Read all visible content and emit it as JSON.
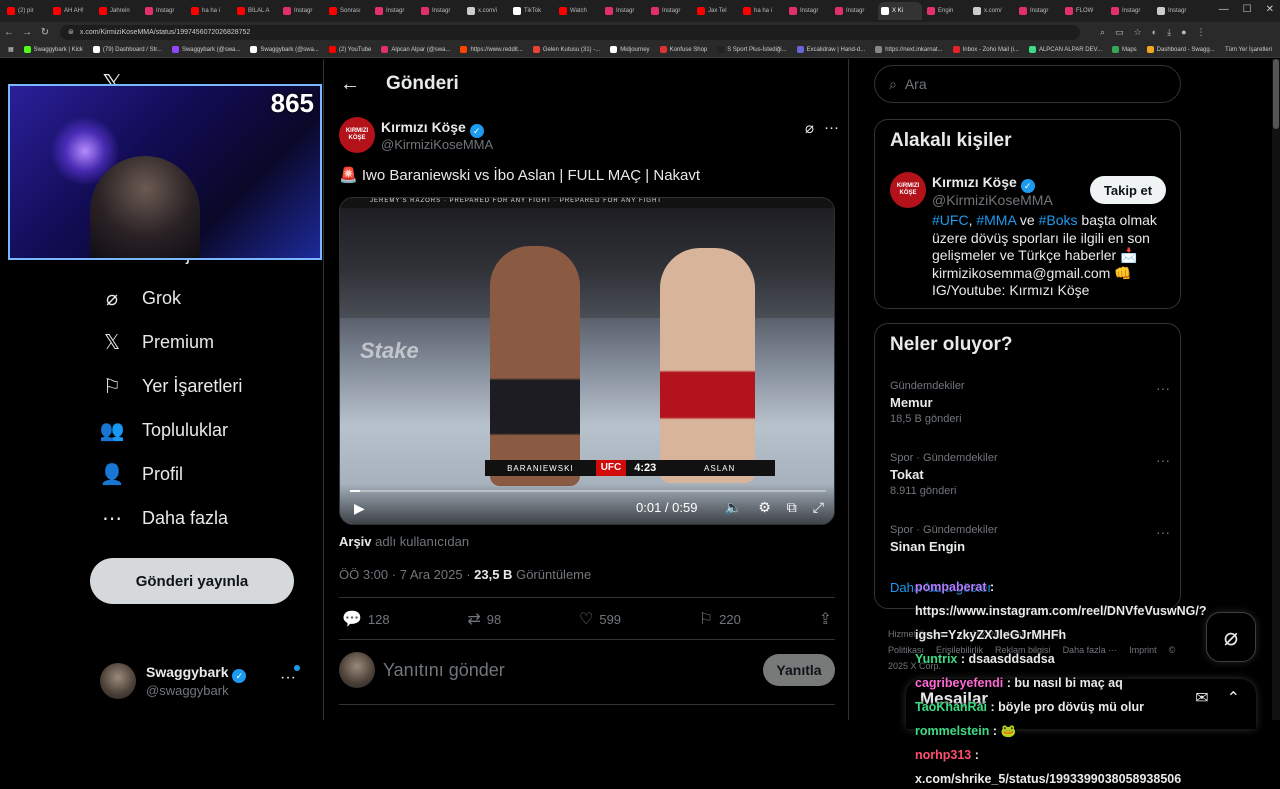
{
  "browser": {
    "tabs": [
      {
        "label": "(2) pir",
        "color": "#ff0000",
        "active": false
      },
      {
        "label": "AH AH!",
        "color": "#ff0000",
        "active": false
      },
      {
        "label": "Jahrein",
        "color": "#ff0000",
        "active": false
      },
      {
        "label": "Instagr",
        "color": "#e1306c",
        "active": false
      },
      {
        "label": "ha ha i",
        "color": "#ff0000",
        "active": false
      },
      {
        "label": "BİLAL A",
        "color": "#ff0000",
        "active": false
      },
      {
        "label": "Instagr",
        "color": "#e1306c",
        "active": false
      },
      {
        "label": "Sonrası",
        "color": "#ff0000",
        "active": false
      },
      {
        "label": "Instagr",
        "color": "#e1306c",
        "active": false
      },
      {
        "label": "Instagr",
        "color": "#e1306c",
        "active": false
      },
      {
        "label": "x.com/i",
        "color": "#cccccc",
        "active": false
      },
      {
        "label": "TikTok",
        "color": "#ffffff",
        "active": false
      },
      {
        "label": "Watch",
        "color": "#ff0000",
        "active": false
      },
      {
        "label": "Instagr",
        "color": "#e1306c",
        "active": false
      },
      {
        "label": "Instagr",
        "color": "#e1306c",
        "active": false
      },
      {
        "label": "Jax Tel",
        "color": "#ff0000",
        "active": false
      },
      {
        "label": "ha ha i",
        "color": "#ff0000",
        "active": false
      },
      {
        "label": "Instagr",
        "color": "#e1306c",
        "active": false
      },
      {
        "label": "Instagr",
        "color": "#e1306c",
        "active": false
      },
      {
        "label": "X Ki",
        "color": "#ffffff",
        "active": true
      },
      {
        "label": "Engin",
        "color": "#e1306c",
        "active": false
      },
      {
        "label": "x.com/",
        "color": "#cccccc",
        "active": false
      },
      {
        "label": "Instagr",
        "color": "#e1306c",
        "active": false
      },
      {
        "label": "FLOW",
        "color": "#e1306c",
        "active": false
      },
      {
        "label": "Instagr",
        "color": "#e1306c",
        "active": false
      },
      {
        "label": "Instagr",
        "color": "#cccccc",
        "active": false
      }
    ],
    "url": "x.com/KirmiziKoseMMA/status/1997456072026828752",
    "bookmarks": [
      {
        "label": "Swaggybark | Kick",
        "color": "#53fc18"
      },
      {
        "label": "(79) Dashboard / Str...",
        "color": "#ffffff"
      },
      {
        "label": "Swaggybark (@swa...",
        "color": "#9146ff"
      },
      {
        "label": "Swaggybark (@swa...",
        "color": "#ffffff"
      },
      {
        "label": "(2) YouTube",
        "color": "#ff0000"
      },
      {
        "label": "Alpcan Alpar (@swa...",
        "color": "#e1306c"
      },
      {
        "label": "https://www.reddit...",
        "color": "#ff4500"
      },
      {
        "label": "Gelen Kutusu (31) -...",
        "color": "#ea4335"
      },
      {
        "label": "Midjourney",
        "color": "#ffffff"
      },
      {
        "label": "Konfuse Shop",
        "color": "#d33"
      },
      {
        "label": "S Sport Plus-İstediği...",
        "color": "#222"
      },
      {
        "label": "Excalidraw | Hand-d...",
        "color": "#6965db"
      },
      {
        "label": "https://next.inkarnat...",
        "color": "#888"
      },
      {
        "label": "Inbox - Zoho Mail (i...",
        "color": "#e42527"
      },
      {
        "label": "ALPCAN ALPAR DEV...",
        "color": "#3ddc84"
      },
      {
        "label": "Maps",
        "color": "#34a853"
      },
      {
        "label": "Dashboard - Swagg...",
        "color": "#f5a623"
      }
    ],
    "all_bookmarks": "Tüm Yer İşaretleri"
  },
  "webcam": {
    "viewer_count": "865"
  },
  "sidebar": {
    "items": [
      {
        "label": "Mesajlar",
        "icon": "envelope-icon",
        "glyph": "✉"
      },
      {
        "label": "Grok",
        "icon": "grok-icon",
        "glyph": "⌀"
      },
      {
        "label": "Premium",
        "icon": "x-premium-icon",
        "glyph": "𝕏"
      },
      {
        "label": "Yer İşaretleri",
        "icon": "bookmark-icon",
        "glyph": "⚐"
      },
      {
        "label": "Topluluklar",
        "icon": "communities-icon",
        "glyph": "👥"
      },
      {
        "label": "Profil",
        "icon": "profile-icon",
        "glyph": "👤"
      },
      {
        "label": "Daha fazla",
        "icon": "more-circle-icon",
        "glyph": "⋯"
      }
    ],
    "post_button": "Gönderi yayınla",
    "account": {
      "name": "Swaggybark",
      "handle": "@swaggybark"
    }
  },
  "main": {
    "header_title": "Gönderi",
    "tweet": {
      "author_name": "Kırmızı Köşe",
      "author_handle": "@KirmiziKoseMMA",
      "avatar_text": "KIRMIZI KÖŞE",
      "text": "🚨 Iwo Baraniewski vs İbo Aslan | FULL MAÇ | Nakavt",
      "video": {
        "banner": "JEREMY'S RAZORS · PREPARED FOR ANY FIGHT · PREPARED FOR ANY FIGHT",
        "mat_logo": "Stake",
        "fighter_left": "BARANIEWSKI",
        "fighter_right": "ASLAN",
        "scorebug_logo": "UFC",
        "clock": "4:23",
        "time_display": "0:01 / 0:59",
        "progress": 0.02
      },
      "archive_name": "Arşiv",
      "archive_suffix": "adlı kullanıcıdan",
      "timestamp": "ÖÖ 3:00 · 7 Ara 2025 · ",
      "views": "23,5 B",
      "views_label": "Görüntüleme",
      "stats": {
        "replies": "128",
        "retweets": "98",
        "likes": "599",
        "bookmarks": "220"
      }
    },
    "reply": {
      "placeholder": "Yanıtını gönder",
      "button": "Yanıtla"
    }
  },
  "right": {
    "search_placeholder": "Ara",
    "related": {
      "title": "Alakalı kişiler",
      "name": "Kırmızı Köşe",
      "handle": "@KirmiziKoseMMA",
      "follow": "Takip et",
      "bio_parts": [
        {
          "text": "#UFC",
          "tag": true
        },
        {
          "text": ", ",
          "tag": false
        },
        {
          "text": "#MMA",
          "tag": true
        },
        {
          "text": " ve ",
          "tag": false
        },
        {
          "text": "#Boks",
          "tag": true
        },
        {
          "text": " başta olmak üzere dövüş sporları ile ilgili en son gelişmeler ve Türkçe haberler 📩 kirmizikosemma@gmail.com 👊 IG/Youtube: Kırmızı Köşe",
          "tag": false
        }
      ]
    },
    "trends": {
      "title": "Neler oluyor?",
      "items": [
        {
          "category": "Gündemdekiler",
          "name": "Memur",
          "count": "18,5 B gönderi"
        },
        {
          "category": "Spor · Gündemdekiler",
          "name": "Tokat",
          "count": "8.911 gönderi"
        },
        {
          "category": "Spor · Gündemdekiler",
          "name": "Sinan Engin",
          "count": ""
        }
      ],
      "show_more": "Daha fazla göster"
    },
    "footer": [
      "Hizmet Şartları",
      "Gizlilik Politikası",
      "Çerez Politikası",
      "Erişilebilirlik",
      "Reklam bilgisi",
      "Daha fazla ···",
      "Imprint",
      "© 2025 X Corp."
    ]
  },
  "messages_dock": {
    "title": "Mesajlar"
  },
  "chat_overlay": [
    {
      "user": "pompaberat",
      "color": "#b07cff",
      "text": " :"
    },
    {
      "user": "",
      "color": "#ffffff",
      "text": "https://www.instagram.com/reel/DNVfeVuswNG/?"
    },
    {
      "user": "",
      "color": "#ffffff",
      "text": "igsh=YzkyZXJleGJrMHFh"
    },
    {
      "user": "Yuntrix",
      "color": "#3ddc84",
      "text": " : dsaasddsadsa"
    },
    {
      "user": "cagribeyefendi",
      "color": "#ff6ad5",
      "text": " : bu nasıl bi maç aq"
    },
    {
      "user": "TaoKhanRai",
      "color": "#3ddc84",
      "text": " : böyle pro dövüş mü olur"
    },
    {
      "user": "rommelstein",
      "color": "#3ddc84",
      "text": " : 🐸"
    },
    {
      "user": "norhp313",
      "color": "#ff4d6d",
      "text": " :"
    },
    {
      "user": "",
      "color": "#ffffff",
      "text": "x.com/shrike_5/status/1993399038058938506"
    }
  ]
}
